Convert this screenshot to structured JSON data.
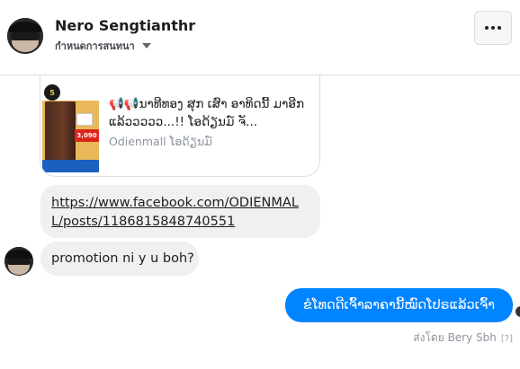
{
  "header": {
    "name": "Nero Sengtianthr",
    "subtitle": "กำหนดการสนทนา",
    "more_icon": "more-horizontal-icon"
  },
  "link_card": {
    "title": "📢📢ນາທີທອງ ສຸກ ເສົາ ອາທິດນີ້ ມາອີກແລ້ວວວວວ...!! ໂອດ້ຽນມ໌ ຈັ...",
    "source": "Odienmall ໂອດ້ຽນມ໌",
    "thumb_badge": "5",
    "thumb_price": "3,090"
  },
  "messages": {
    "link_text": "https://www.facebook.com/ODIENMALL/posts/1186815848740551",
    "incoming_text": "promotion ni y u boh?",
    "outgoing_text": "ຂໍໂທດດີເຈົ້າລາຄານີ້ໝົດໂປຣແລ້ວເຈົ້າ"
  },
  "footer": {
    "sent_by": "ส่งโดย Bery Sbh",
    "help": "[?]"
  },
  "colors": {
    "outgoing_bubble": "#0084ff",
    "incoming_bubble": "#f0f0f0"
  }
}
